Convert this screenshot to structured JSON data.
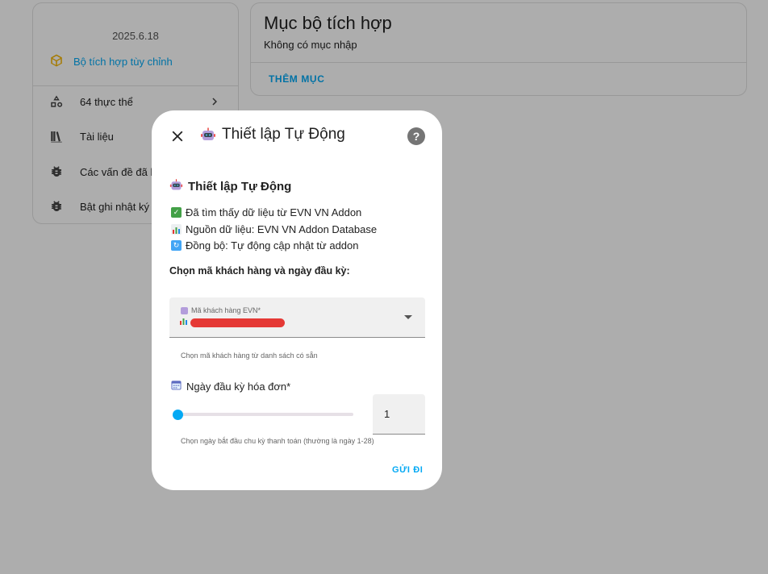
{
  "sidebar": {
    "version": "2025.6.18",
    "custom_integration": "Bộ tích hợp tùy chỉnh",
    "items": [
      {
        "label": "64 thực thể",
        "icon": "shapes-icon"
      },
      {
        "label": "Tài liệu",
        "icon": "bookshelf-icon"
      },
      {
        "label": "Các vấn đề đã biết",
        "icon": "bug-icon"
      },
      {
        "label": "Bật ghi nhật ký gỡ lỗi",
        "icon": "bug-play-icon"
      }
    ]
  },
  "integration_entries": {
    "title": "Mục bộ tích hợp",
    "empty_text": "Không có mục nhập",
    "add_button": "THÊM MỤC"
  },
  "dialog": {
    "title": "Thiết lập Tự Động",
    "section_title": "Thiết lập Tự Động",
    "info_lines": [
      {
        "text": "Đã tìm thấy dữ liệu từ EVN VN Addon",
        "icon": "check-mark-icon",
        "color": "#43a047"
      },
      {
        "text": "Nguồn dữ liệu: EVN VN Addon Database",
        "icon": "bar-chart-icon",
        "color": "#90a4ae"
      },
      {
        "text": "Đồng bộ: Tự động cập nhật từ addon",
        "icon": "sync-icon",
        "color": "#42a5f5"
      }
    ],
    "prompt": "Chọn mã khách hàng và ngày đầu kỳ:",
    "customer_select": {
      "label": "Mã khách hàng EVN*",
      "value_redacted": true,
      "helper": "Chọn mã khách hàng từ danh sách có sẵn"
    },
    "billing_day": {
      "label": "Ngày đầu kỳ hóa đơn*",
      "value": "1",
      "min": 1,
      "max": 28,
      "helper": "Chọn ngày bắt đầu chu kỳ thanh toán (thường là ngày 1-28)"
    },
    "submit_label": "GỬI ĐI"
  },
  "colors": {
    "accent": "#03a9f4",
    "integration_icon": "#f4b400",
    "scrim": "rgba(0,0,0,0.32)"
  }
}
